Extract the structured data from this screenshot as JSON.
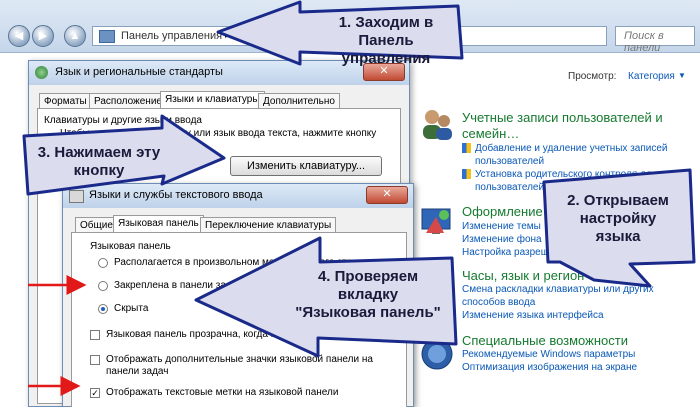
{
  "explorer": {
    "address": "Панель управления",
    "search_placeholder": "Поиск в панели управления"
  },
  "control_panel": {
    "view_label": "Просмотр:",
    "view_value": "Категория",
    "sections": [
      {
        "title": "Учетные записи пользователей и",
        "title2": "семейн…",
        "links": [
          "Добавление и удаление учетных записей",
          "пользователей",
          "Установка родительского контроля для всех",
          "пользователей"
        ]
      },
      {
        "title": "Оформление",
        "links": [
          "Изменение темы",
          "Изменение фона",
          "Настройка разреш"
        ]
      },
      {
        "title": "Часы, язык и регион",
        "links": [
          "Смена раскладки клавиатуры или других",
          "способов ввода",
          "Изменение языка интерфейса"
        ]
      },
      {
        "title": "Специальные возможности",
        "links": [
          "Рекомендуемые Windows параметры",
          "Оптимизация изображения на экране"
        ]
      }
    ]
  },
  "regional_dialog": {
    "title": "Язык и региональные стандарты",
    "close": "✕",
    "tabs": [
      "Форматы",
      "Расположение",
      "Языки и клавиатуры",
      "Дополнительно"
    ],
    "group_title": "Клавиатуры и другие языки ввода",
    "description": "Чтобы изменить клавиатуру или язык ввода текста, нажмите кнопку",
    "change_button": "Изменить клавиатуру..."
  },
  "textsvc_dialog": {
    "title": "Языки и службы текстового ввода",
    "close": "✕",
    "tabs": [
      "Общие",
      "Языковая панель",
      "Переключение клавиатуры"
    ],
    "group_title": "Языковая панель",
    "radios": [
      "Располагается в произвольном месте рабочего стола",
      "Закреплена в панели задач",
      "Скрыта"
    ],
    "checks": [
      "Языковая панель прозрачна, когда неактивна",
      "Отображать дополнительные значки языковой панели на",
      "панели задач",
      "Отображать текстовые метки на языковой панели"
    ]
  },
  "callouts": {
    "step1_line1": "1. Заходим в Панель",
    "step1_line2": "управления",
    "step2_line1": "2. Открываем",
    "step2_line2": "настройку",
    "step2_line3": "языка",
    "step3_line1": "3. Нажимаем эту",
    "step3_line2": "кнопку",
    "step4_line1": "4. Проверяем",
    "step4_line2": "вкладку",
    "step4_line3": "\"Языковая панель\""
  },
  "colors": {
    "link": "#0a58b7",
    "heading": "#157a2f",
    "arrow_fill": "#dcdcef",
    "arrow_stroke": "#1a2a8a",
    "red_arrow": "#e11919"
  }
}
